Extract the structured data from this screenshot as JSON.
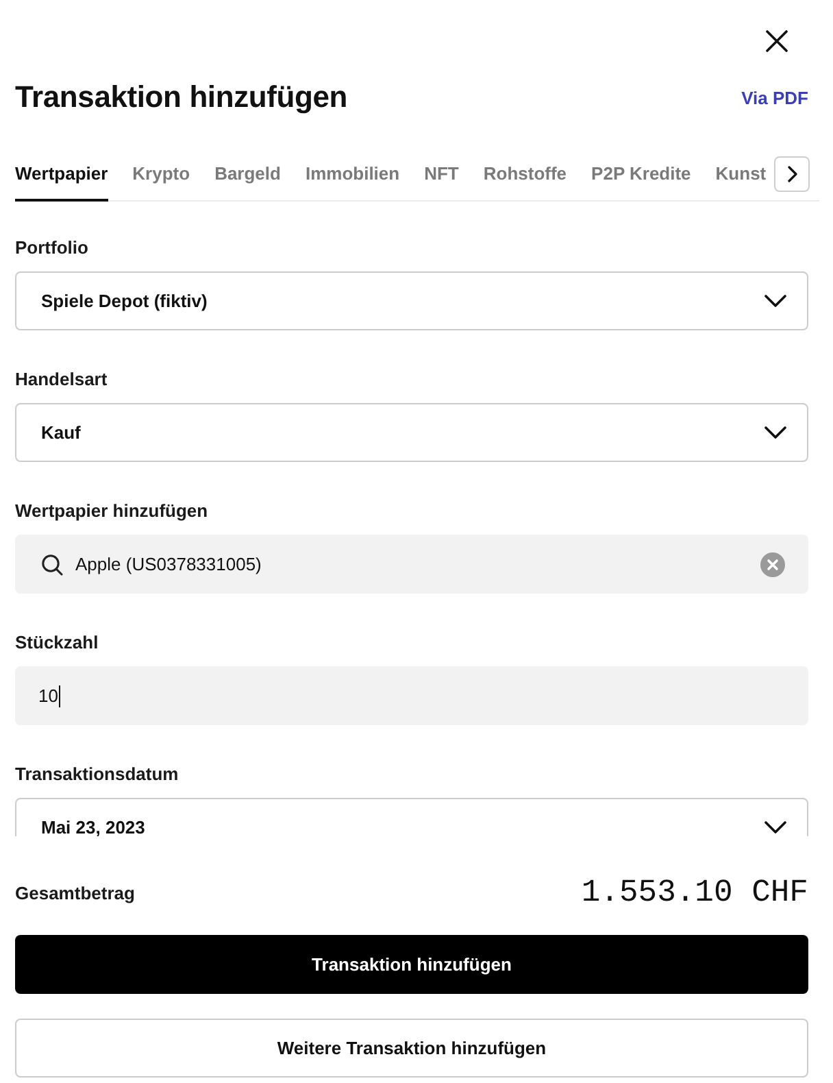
{
  "header": {
    "title": "Transaktion hinzufügen",
    "link": "Via PDF"
  },
  "tabs": [
    {
      "label": "Wertpapier",
      "selected": true
    },
    {
      "label": "Krypto",
      "selected": false
    },
    {
      "label": "Bargeld",
      "selected": false
    },
    {
      "label": "Immobilien",
      "selected": false
    },
    {
      "label": "NFT",
      "selected": false
    },
    {
      "label": "Rohstoffe",
      "selected": false
    },
    {
      "label": "P2P Kredite",
      "selected": false
    },
    {
      "label": "Kunst",
      "selected": false
    }
  ],
  "fields": [
    {
      "kind": "select",
      "label": "Portfolio",
      "value": "Spiele Depot (fiktiv)"
    },
    {
      "kind": "select",
      "label": "Handelsart",
      "value": "Kauf"
    },
    {
      "kind": "search",
      "label": "Wertpapier hinzufügen",
      "value": "Apple (US0378331005)"
    },
    {
      "kind": "number",
      "label": "Stückzahl",
      "value": "10",
      "focused": true
    },
    {
      "kind": "select",
      "label": "Transaktionsdatum",
      "value": "Mai 23, 2023"
    }
  ],
  "summary": {
    "label": "Gesamtbetrag",
    "amount": "1.553.10 CHF"
  },
  "buttons": [
    {
      "kind": "primary",
      "label": "Transaktion hinzufügen"
    },
    {
      "kind": "secondary",
      "label": "Weitere Transaktion hinzufügen"
    }
  ]
}
